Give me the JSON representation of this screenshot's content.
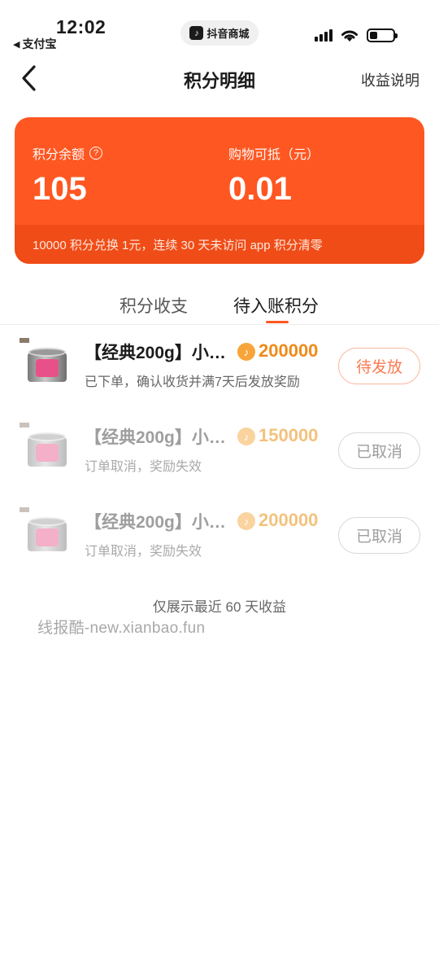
{
  "status_bar": {
    "time": "12:02",
    "back_app": "支付宝",
    "back_arrow": "◀",
    "app_pill": "抖音商城",
    "icons": [
      "signal-icon",
      "wifi-icon",
      "battery-icon"
    ]
  },
  "nav": {
    "title": "积分明细",
    "right_link": "收益说明"
  },
  "summary": {
    "balance_label": "积分余额",
    "balance_value": "105",
    "deduct_label": "购物可抵（元）",
    "deduct_value": "0.01",
    "footer_note": "10000 积分兑换 1元，连续 30 天未访问 app 积分清零",
    "accent_color": "#fe5722"
  },
  "tabs": {
    "tab1": "积分收支",
    "tab2": "待入账积分",
    "active": "待入账积分"
  },
  "items": [
    {
      "title": "【经典200g】小…",
      "points": "200000",
      "subtitle": "已下单，确认收货并满7天后发放奖励",
      "status": "待发放"
    },
    {
      "title": "【经典200g】小…",
      "points": "150000",
      "subtitle": "订单取消，奖励失效",
      "status": "已取消"
    },
    {
      "title": "【经典200g】小…",
      "points": "200000",
      "subtitle": "订单取消，奖励失效",
      "status": "已取消"
    }
  ],
  "footer_note": "仅展示最近 60 天收益",
  "watermark": "线报酷-new.xianbao.fun"
}
